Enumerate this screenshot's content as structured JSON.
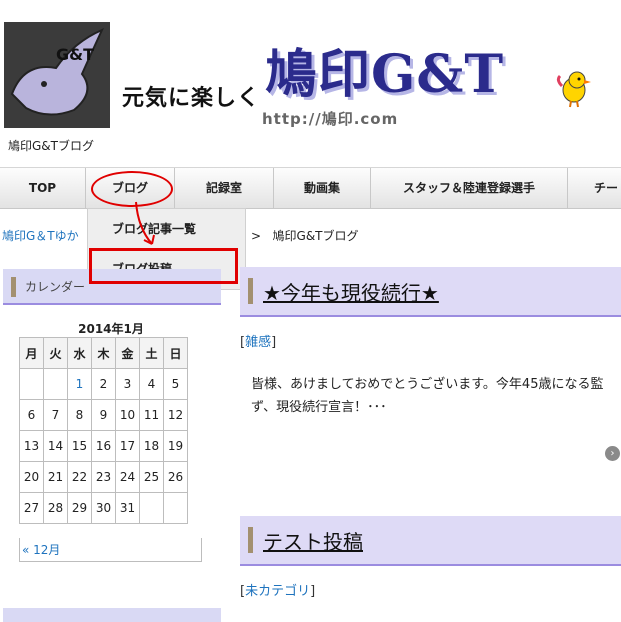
{
  "header": {
    "logo_text": "G&T 元気に楽しく",
    "tagline": "元気に楽しく",
    "site_title": "鳩印G&T",
    "url_text": "http://鳩印.com",
    "caption": "鳩印G&Tブログ"
  },
  "nav": {
    "items": [
      "TOP",
      "ブログ",
      "記録室",
      "動画集",
      "スタッフ＆陸連登録選手",
      "チー"
    ]
  },
  "dropdown": {
    "items": [
      "ブログ記事一覧",
      "ブログ投稿"
    ]
  },
  "breadcrumb": {
    "left": "鳩印G＆Tゆか",
    "separator": ">",
    "current": "鳩印G&Tブログ"
  },
  "sidebar": {
    "calendar_title": "カレンダー",
    "month": "2014年1月",
    "weekdays": [
      "月",
      "火",
      "水",
      "木",
      "金",
      "土",
      "日"
    ],
    "weeks": [
      [
        "",
        "",
        "1",
        "2",
        "3",
        "4",
        "5"
      ],
      [
        "6",
        "7",
        "8",
        "9",
        "10",
        "11",
        "12"
      ],
      [
        "13",
        "14",
        "15",
        "16",
        "17",
        "18",
        "19"
      ],
      [
        "20",
        "21",
        "22",
        "23",
        "24",
        "25",
        "26"
      ],
      [
        "27",
        "28",
        "29",
        "30",
        "31",
        "",
        ""
      ]
    ],
    "prev_link": "« 12月"
  },
  "posts": [
    {
      "title": "★今年も現役続行★",
      "category": "雑感",
      "excerpt_1": "皆様、あけましておめでとうございます。今年45歳になる監",
      "excerpt_2": "ず、現役続行宣言！･･･"
    },
    {
      "title": "テスト投稿",
      "category": "未カテゴリ"
    }
  ],
  "more_icon": "arrow-right-circle-icon",
  "colors": {
    "header_band": "#dedaf6",
    "header_border": "#9b8ce0",
    "title_bar": "#a39070",
    "annotation": "#e00000"
  }
}
